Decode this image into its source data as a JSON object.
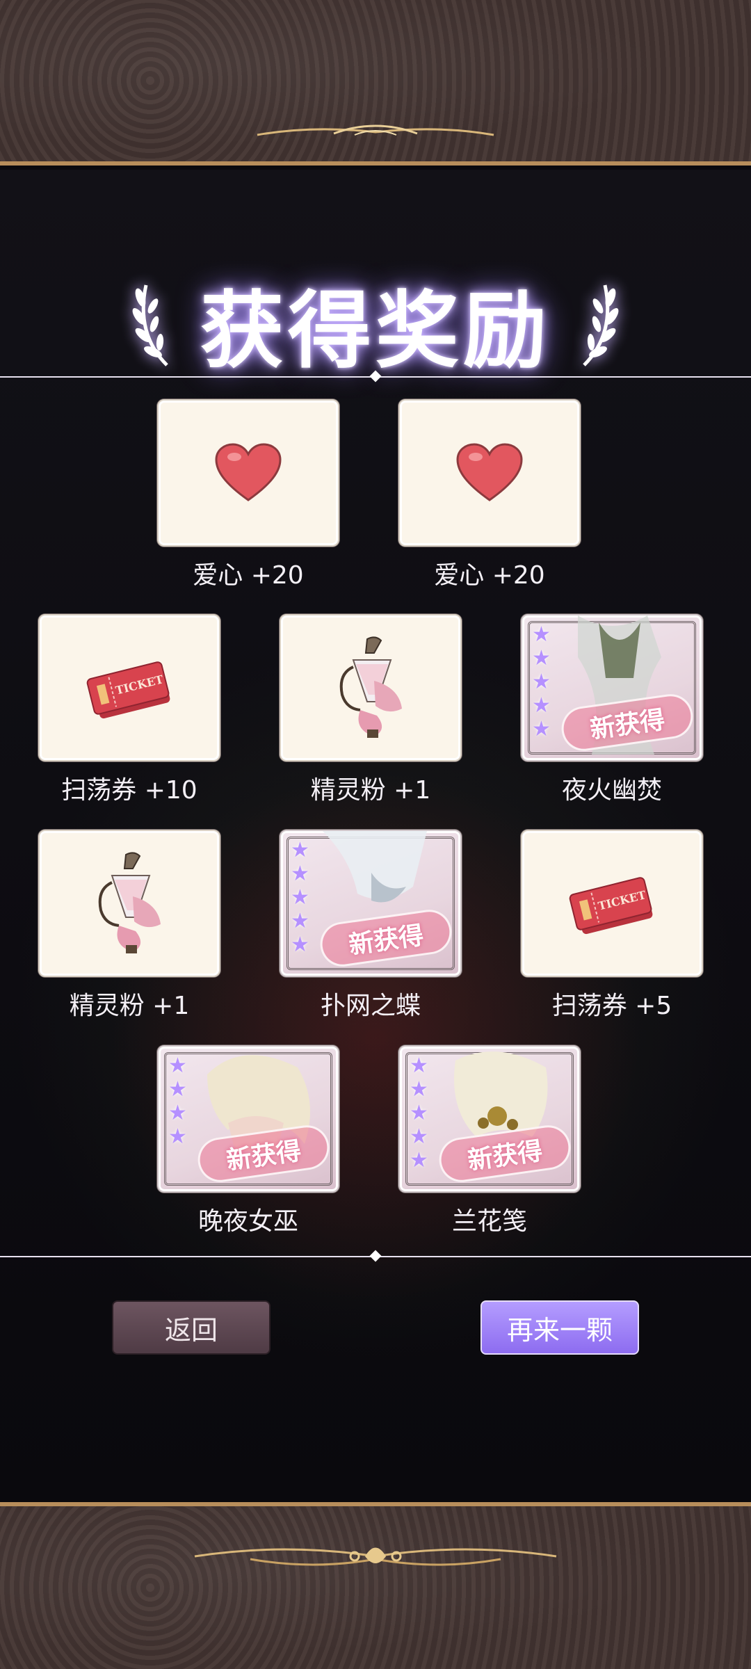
{
  "title": "获得奖励",
  "badge_text": "新获得",
  "colors": {
    "accent_purple": "#9a7fff",
    "frame_gold": "#b88e5b",
    "card_bg": "#fbf5ea"
  },
  "rewards": [
    {
      "label": "爱心 +20",
      "icon": "heart-icon",
      "rare": false
    },
    {
      "label": "爱心 +20",
      "icon": "heart-icon",
      "rare": false
    },
    {
      "label": "扫荡券 +10",
      "icon": "ticket-icon",
      "rare": false
    },
    {
      "label": "精灵粉 +1",
      "icon": "perfume-bottle-icon",
      "rare": false
    },
    {
      "label": "夜火幽焚",
      "icon": "outfit-card-image",
      "rare": true
    },
    {
      "label": "精灵粉 +1",
      "icon": "perfume-bottle-icon",
      "rare": false
    },
    {
      "label": "扑网之蝶",
      "icon": "outfit-card-image",
      "rare": true
    },
    {
      "label": "扫荡券 +5",
      "icon": "ticket-icon",
      "rare": false
    },
    {
      "label": "晚夜女巫",
      "icon": "outfit-card-image",
      "rare": true
    },
    {
      "label": "兰花笺",
      "icon": "outfit-card-image",
      "rare": true
    }
  ],
  "buttons": {
    "back": "返回",
    "again": "再来一颗"
  }
}
